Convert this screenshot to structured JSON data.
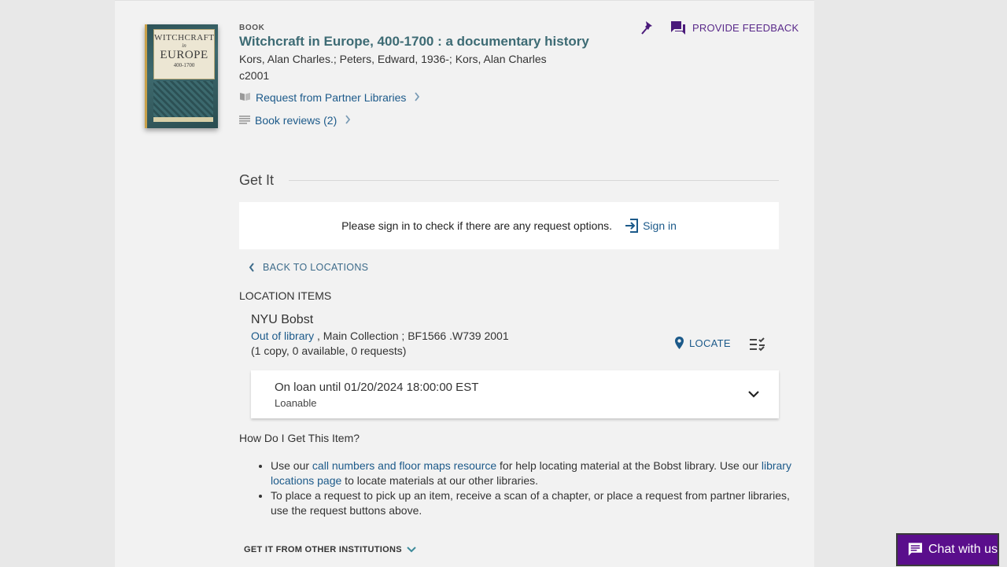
{
  "record": {
    "type": "BOOK",
    "title": "Witchcraft in Europe, 400-1700 : a documentary history",
    "authors": "Kors, Alan Charles.; Peters, Edward, 1936-; Kors, Alan Charles",
    "date": "c2001",
    "cover": {
      "line1": "WITCHCRAFT",
      "line2": "in",
      "line3": "EUROPE",
      "line4": "400-1700"
    }
  },
  "links": {
    "request_partner": "Request from Partner Libraries",
    "book_reviews": "Book reviews (2)"
  },
  "actions": {
    "feedback": "PROVIDE FEEDBACK"
  },
  "get_it": {
    "title": "Get It",
    "signin_message": "Please sign in to check if there are any request options.",
    "signin_label": "Sign in",
    "back_label": "BACK TO LOCATIONS",
    "location_items_label": "LOCATION ITEMS",
    "library": "NYU Bobst",
    "status_link": "Out of library",
    "location_detail": " , Main Collection ; BF1566 .W739 2001",
    "copies": "(1 copy, 0 available, 0 requests)",
    "locate_label": "LOCATE",
    "item": {
      "due": "On loan until 01/20/2024 18:00:00 EST",
      "policy": "Loanable"
    }
  },
  "help": {
    "heading": "How Do I Get This Item?",
    "item1_pre": "Use our ",
    "item1_link1": "call numbers and floor maps resource",
    "item1_mid": " for help locating material at the Bobst library. Use our ",
    "item1_link2": "library locations page",
    "item1_post": " to locate materials at our other libraries.",
    "item2": "To place a request to pick up an item, receive a scan of a chapter, or place a request from partner libraries, use the request buttons above."
  },
  "other_institutions": "GET IT FROM OTHER INSTITUTIONS",
  "chat": {
    "label": "Chat with us"
  },
  "colors": {
    "link": "#1c5a8a",
    "title": "#3d6b74",
    "accent_purple": "#5a2a8a",
    "chat_bg": "#5a0e8c"
  }
}
